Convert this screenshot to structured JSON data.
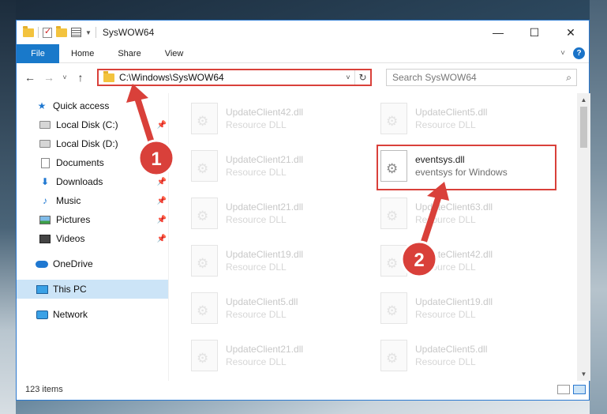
{
  "window": {
    "title": "SysWOW64"
  },
  "window_controls": {
    "minimize": "—",
    "maximize": "☐",
    "close": "✕"
  },
  "ribbon": {
    "file": "File",
    "tabs": [
      "Home",
      "Share",
      "View"
    ],
    "help": "?"
  },
  "nav": {
    "back": "←",
    "forward": "→",
    "recent": "˅",
    "up": "↑"
  },
  "address": {
    "path": "C:\\Windows\\SysWOW64",
    "refresh": "↻",
    "dropdown": "˅"
  },
  "search": {
    "placeholder": "Search SysWOW64",
    "icon": "⌕"
  },
  "sidebar": {
    "quick_access": "Quick access",
    "items": [
      {
        "label": "Local Disk (C:)",
        "icon": "disk-icon",
        "pinned": true
      },
      {
        "label": "Local Disk (D:)",
        "icon": "disk-icon",
        "pinned": false
      },
      {
        "label": "Documents",
        "icon": "documents-icon",
        "pinned": true
      },
      {
        "label": "Downloads",
        "icon": "downloads-icon",
        "pinned": true
      },
      {
        "label": "Music",
        "icon": "music-icon",
        "pinned": true
      },
      {
        "label": "Pictures",
        "icon": "pictures-icon",
        "pinned": true
      },
      {
        "label": "Videos",
        "icon": "videos-icon",
        "pinned": true
      }
    ],
    "onedrive": "OneDrive",
    "this_pc": "This PC",
    "network": "Network"
  },
  "files": [
    {
      "name": "UpdateClient42.dll",
      "type": "Resource DLL",
      "highlighted": false
    },
    {
      "name": "UpdateClient5.dll",
      "type": "Resource DLL",
      "highlighted": false
    },
    {
      "name": "UpdateClient21.dll",
      "type": "Resource DLL",
      "highlighted": false
    },
    {
      "name": "eventsys.dll",
      "type": "eventsys for Windows",
      "highlighted": true
    },
    {
      "name": "UpdateClient21.dll",
      "type": "Resource DLL",
      "highlighted": false
    },
    {
      "name": "UpdateClient63.dll",
      "type": "Resource DLL",
      "highlighted": false
    },
    {
      "name": "UpdateClient19.dll",
      "type": "Resource DLL",
      "highlighted": false
    },
    {
      "name": "UpdateClient42.dll",
      "type": "Resource DLL",
      "highlighted": false
    },
    {
      "name": "UpdateClient5.dll",
      "type": "Resource DLL",
      "highlighted": false
    },
    {
      "name": "UpdateClient19.dll",
      "type": "Resource DLL",
      "highlighted": false
    },
    {
      "name": "UpdateClient21.dll",
      "type": "Resource DLL",
      "highlighted": false
    },
    {
      "name": "UpdateClient5.dll",
      "type": "Resource DLL",
      "highlighted": false
    }
  ],
  "status": {
    "item_count": "123 items"
  },
  "annotations": {
    "step1": "1",
    "step2": "2",
    "color": "#d9403a"
  }
}
